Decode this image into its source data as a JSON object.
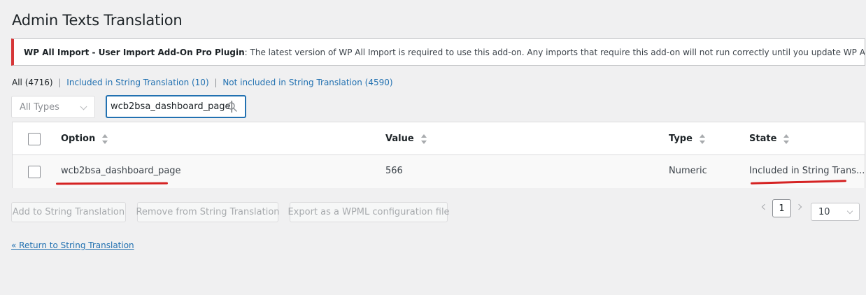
{
  "page": {
    "title": "Admin Texts Translation"
  },
  "notice": {
    "plugin": "WP All Import - User Import Add-On Pro Plugin",
    "message": ": The latest version of WP All Import is required to use this add-on. Any imports that require this add-on will not run correctly until you update WP All Import.",
    "accent_color": "#d63638"
  },
  "filters": {
    "all": "All (4716)",
    "included": "Included in String Translation (10)",
    "not_included": "Not included in String Translation (4590)",
    "separator": "|"
  },
  "type_select": {
    "value": "All Types"
  },
  "search": {
    "value": "wcb2bsa_dashboard_page",
    "icon": "search-icon"
  },
  "table": {
    "columns": [
      "Option",
      "Value",
      "Type",
      "State"
    ],
    "rows": [
      {
        "option": "wcb2bsa_dashboard_page",
        "value": "566",
        "type": "Numeric",
        "state": "Included in String Trans..."
      }
    ]
  },
  "actions": {
    "add": "Add to String Translation",
    "remove": "Remove from String Translation",
    "export": "Export as a WPML configuration file"
  },
  "pagination": {
    "page": "1",
    "per_page": "10"
  },
  "return_link": "« Return to String Translation",
  "colors": {
    "link": "#2271b1",
    "annotation": "#d52323"
  }
}
